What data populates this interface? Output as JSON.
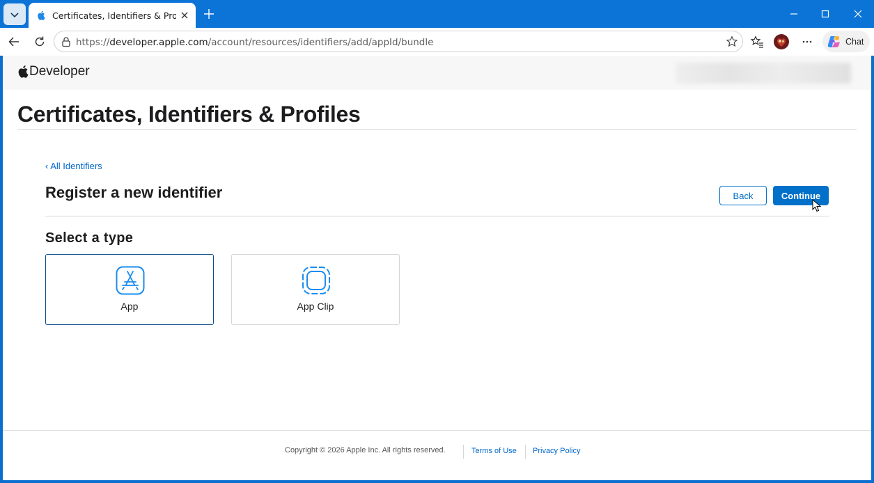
{
  "browser": {
    "tab_title": "Certificates, Identifiers & Profiles -",
    "url_prefix": "https://",
    "url_host": "developer.apple.com",
    "url_path": "/account/resources/identifiers/add/appId/bundle",
    "chat_label": "Chat"
  },
  "header": {
    "brand": "Developer"
  },
  "page": {
    "title": "Certificates, Identifiers & Profiles",
    "back_link": "‹ All Identifiers",
    "section_title": "Register a new identifier",
    "back_button": "Back",
    "continue_button": "Continue",
    "select_type_label": "Select a type",
    "types": [
      {
        "label": "App",
        "icon": "app-store-icon",
        "selected": true
      },
      {
        "label": "App Clip",
        "icon": "app-clip-icon",
        "selected": false
      }
    ]
  },
  "footer": {
    "copyright": "Copyright © 2026 Apple Inc. All rights reserved.",
    "terms": "Terms of Use",
    "privacy": "Privacy Policy"
  },
  "colors": {
    "accent": "#0070c9",
    "link": "#0066cc",
    "titlebar": "#0b74d6"
  }
}
